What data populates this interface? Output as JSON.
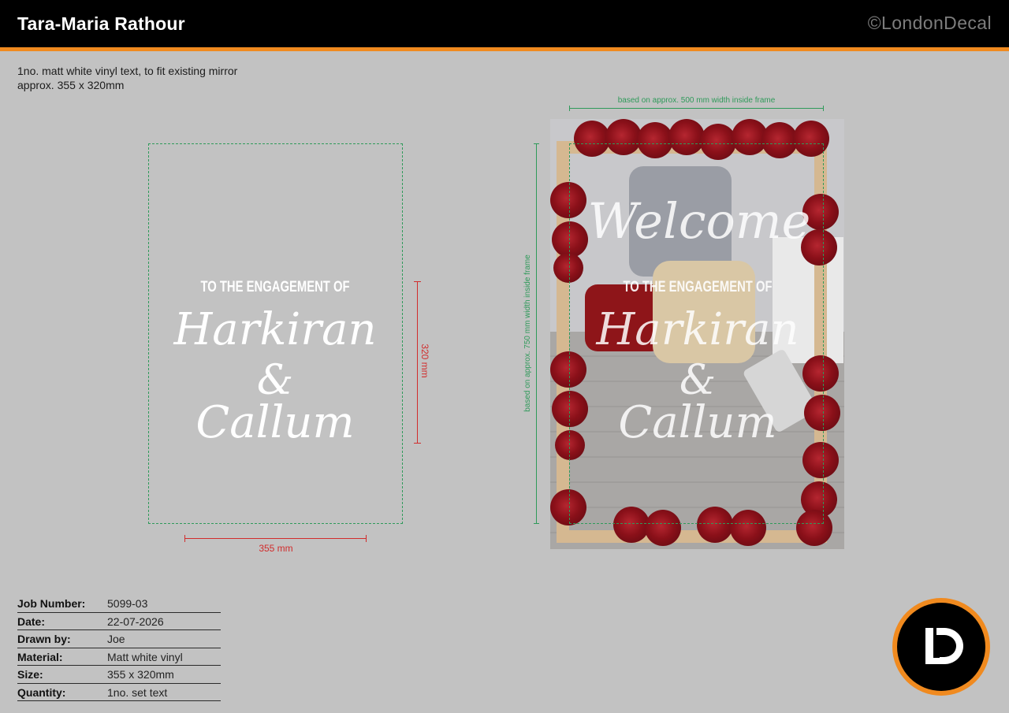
{
  "header": {
    "client_name": "Tara-Maria Rathour",
    "copyright": "©LondonDecal"
  },
  "description": {
    "line1": "1no. matt white vinyl text, to fit existing mirror",
    "line2": "approx. 355 x 320mm"
  },
  "design": {
    "line_top": "TO THE ENGAGEMENT OF",
    "name1": "Harkiran",
    "ampersand": "&",
    "name2": "Callum",
    "height_label": "320 mm",
    "width_label": "355 mm"
  },
  "mockup": {
    "welcome": "Welcome",
    "width_note": "based on approx. 500 mm width inside frame",
    "height_note": "based on approx. 750 mm width inside frame"
  },
  "spec": [
    {
      "label": "Job Number:",
      "value": "5099-03"
    },
    {
      "label": "Date:",
      "value": "22-07-2026"
    },
    {
      "label": "Drawn by:",
      "value": "Joe"
    },
    {
      "label": "Material:",
      "value": "Matt white vinyl"
    },
    {
      "label": "Size:",
      "value": "355 x 320mm"
    },
    {
      "label": "Quantity:",
      "value": "1no. set text"
    }
  ],
  "colors": {
    "accent": "#f08a1f",
    "dimension_red": "#d12c2c",
    "guide_green": "#2f9a5a",
    "background": "#c2c2c2"
  },
  "logo": {
    "name": "londondecal-ld-logo"
  }
}
